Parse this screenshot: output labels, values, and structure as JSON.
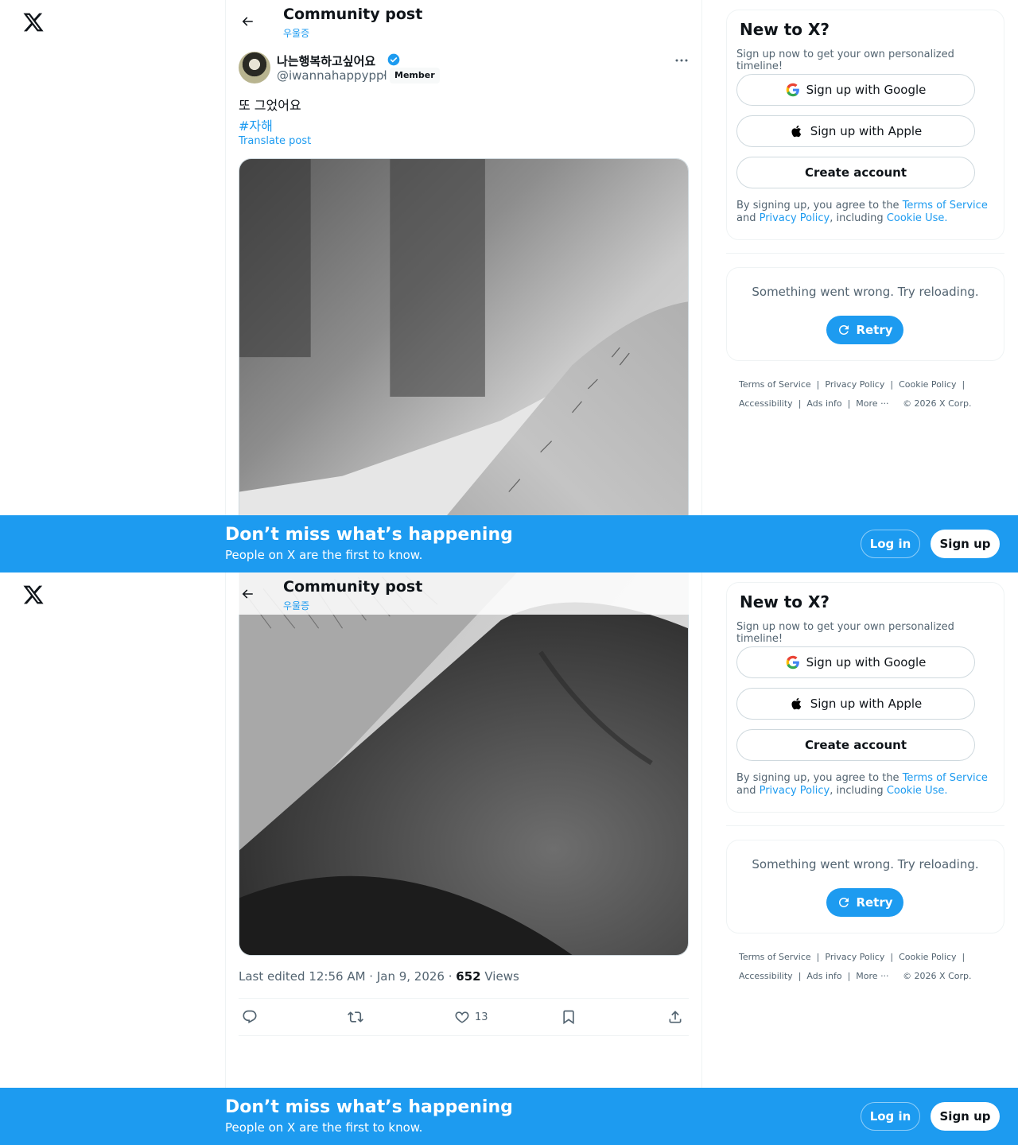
{
  "header": {
    "title": "Community post",
    "community": "우울증"
  },
  "post": {
    "display_name": "나는행복하고싶어요",
    "handle": "@iwannahappyppl",
    "separator": "·",
    "badge": "Member",
    "text": "또 그었어요",
    "hashtag": "#자해",
    "translate": "Translate post",
    "edited_prefix": "Last edited 12:56 AM · Jan 9, 2026 · ",
    "views_count": "652",
    "views_label": " Views",
    "likes": "13"
  },
  "signup_card": {
    "title": "New to X?",
    "subtitle": "Sign up now to get your own personalized timeline!",
    "google": "Sign up with Google",
    "apple": "Sign up with Apple",
    "create": "Create account",
    "legal_1": "By signing up, you agree to the ",
    "terms": "Terms of Service",
    "legal_2": " and ",
    "privacy": "Privacy Policy",
    "legal_3": ", including ",
    "cookie": "Cookie Use."
  },
  "error_card": {
    "message": "Something went wrong. Try reloading.",
    "retry": "Retry"
  },
  "footer": {
    "terms": "Terms of Service",
    "privacy": "Privacy Policy",
    "cookie": "Cookie Policy",
    "accessibility": "Accessibility",
    "ads": "Ads info",
    "more": "More ···",
    "copyright": "© 2026 X Corp."
  },
  "banner": {
    "title": "Don’t miss what’s happening",
    "subtitle": "People on X are the first to know.",
    "login": "Log in",
    "signup": "Sign up"
  },
  "colors": {
    "accent": "#1d9bf0",
    "text": "#0f1419",
    "muted": "#536471",
    "border": "#eff3f4"
  }
}
